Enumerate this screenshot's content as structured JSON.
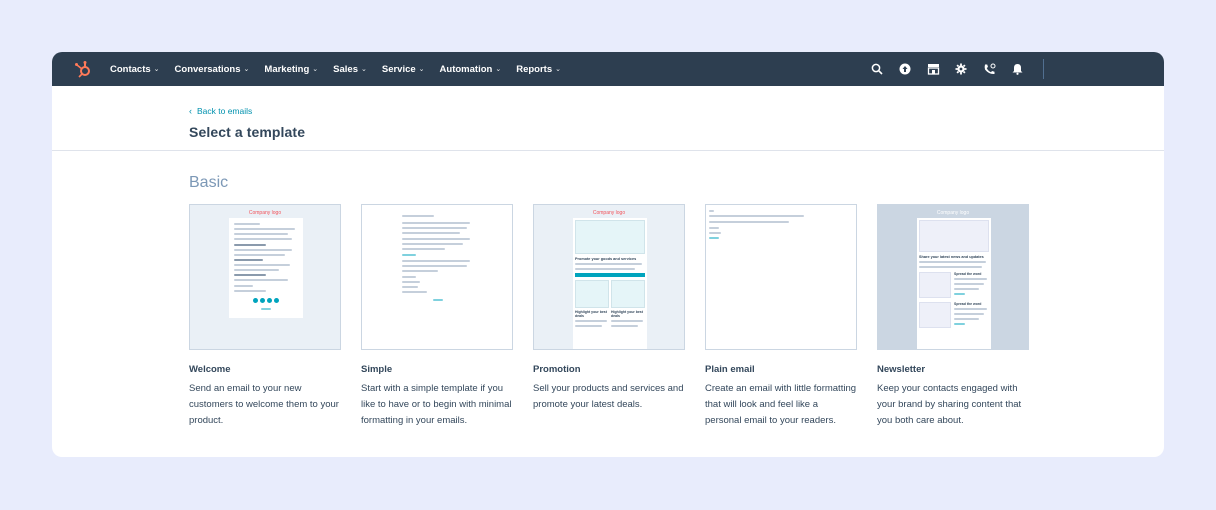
{
  "nav": {
    "items": [
      {
        "label": "Contacts"
      },
      {
        "label": "Conversations"
      },
      {
        "label": "Marketing"
      },
      {
        "label": "Sales"
      },
      {
        "label": "Service"
      },
      {
        "label": "Automation"
      },
      {
        "label": "Reports"
      }
    ],
    "icons": [
      "search-icon",
      "upgrade-icon",
      "marketplace-icon",
      "settings-icon",
      "calling-icon",
      "notifications-icon"
    ]
  },
  "header": {
    "back_label": "Back to emails",
    "title": "Select a template"
  },
  "section": {
    "title": "Basic"
  },
  "templates": [
    {
      "name": "Welcome",
      "description": "Send an email to your new customers to welcome them to your product.",
      "thumb_brand": "Company logo"
    },
    {
      "name": "Simple",
      "description": "Start with a simple template if you like to have or to begin with minimal formatting in your emails."
    },
    {
      "name": "Promotion",
      "description": "Sell your products and services and promote your latest deals.",
      "thumb_brand": "Company logo",
      "thumb_heading": "Promote your goods and services",
      "thumb_sub1": "Highlight your best deals",
      "thumb_sub2": "Highlight your best deals"
    },
    {
      "name": "Plain email",
      "description": "Create an email with little formatting that will look and feel like a personal email to your readers."
    },
    {
      "name": "Newsletter",
      "description": "Keep your contacts engaged with your brand by sharing content that you both care about.",
      "thumb_brand": "Company logo",
      "thumb_heading": "Share your latest news and updates",
      "thumb_sub1": "Spread the word",
      "thumb_sub2": "Spread the word"
    }
  ],
  "colors": {
    "nav_bg": "#2d3e50",
    "link": "#0091ae",
    "accent": "#00a4bd",
    "brand": "#f2545b",
    "heading_muted": "#7c98b6"
  }
}
